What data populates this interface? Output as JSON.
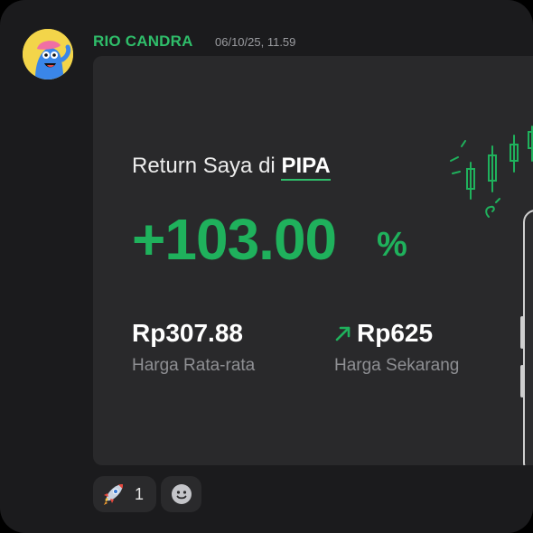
{
  "message": {
    "author": "RIO CANDRA",
    "timestamp": "06/10/25, 11.59"
  },
  "card": {
    "title_prefix": "Return Saya di",
    "stock": "PIPA",
    "return_value": "+103.00",
    "return_unit": "%",
    "average_price": "Rp307.88",
    "average_label": "Harga Rata-rata",
    "current_price": "Rp625",
    "current_label": "Harga Sekarang"
  },
  "reactions": [
    {
      "icon": "rocket-icon",
      "count": "1"
    }
  ],
  "add_reaction_icon": "smile-icon",
  "colors": {
    "accent_green": "#1fb15c",
    "author_green": "#2fbe6a",
    "background": "#1b1b1d",
    "card": "#29292b"
  }
}
